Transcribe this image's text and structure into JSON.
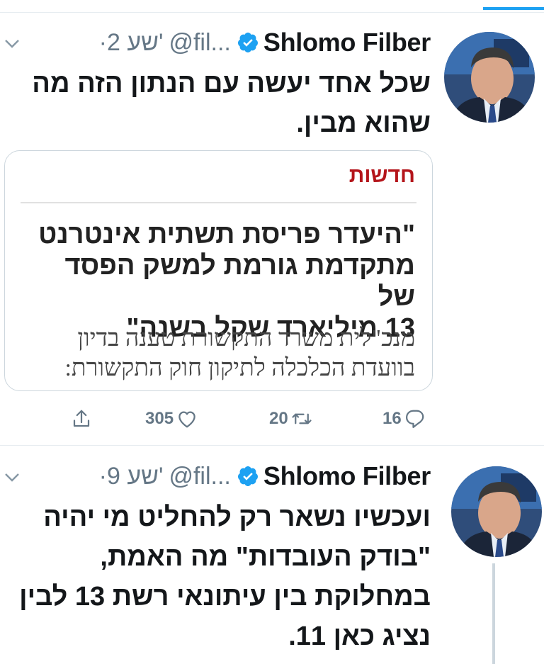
{
  "colors": {
    "accent": "#1da1f2",
    "muted": "#657786",
    "text": "#14171a",
    "source": "#b4151b"
  },
  "tweets": [
    {
      "name": "Shlomo Filber",
      "handle": "@fil...",
      "time": "·2 שע'",
      "text_lines": [
        "שכל אחד יעשה עם הנתון הזה מה",
        "שהוא מבין."
      ],
      "card": {
        "source": "חדשות",
        "headline_lines": [
          "\"היעדר פריסת תשתית אינטרנט",
          "מתקדמת גורמת למשק הפסד של",
          "13 מיליארד שקל בשנה\""
        ],
        "body_lines": [
          "מנכ\"לית משרד התקשורת טענה בדיון",
          "בוועדת הכלכלה לתיקון חוק התקשורת:"
        ]
      },
      "replies": "16",
      "retweets": "20",
      "likes": "305"
    },
    {
      "name": "Shlomo Filber",
      "handle": "@fil...",
      "time": "·9 שע'",
      "text_lines": [
        "ועכשיו נשאר רק להחליט מי יהיה",
        "\"בודק העובדות\" מה האמת,",
        "במחלוקת בין עיתונאי רשת 13 לבין",
        "נציג כאן 11."
      ]
    }
  ]
}
